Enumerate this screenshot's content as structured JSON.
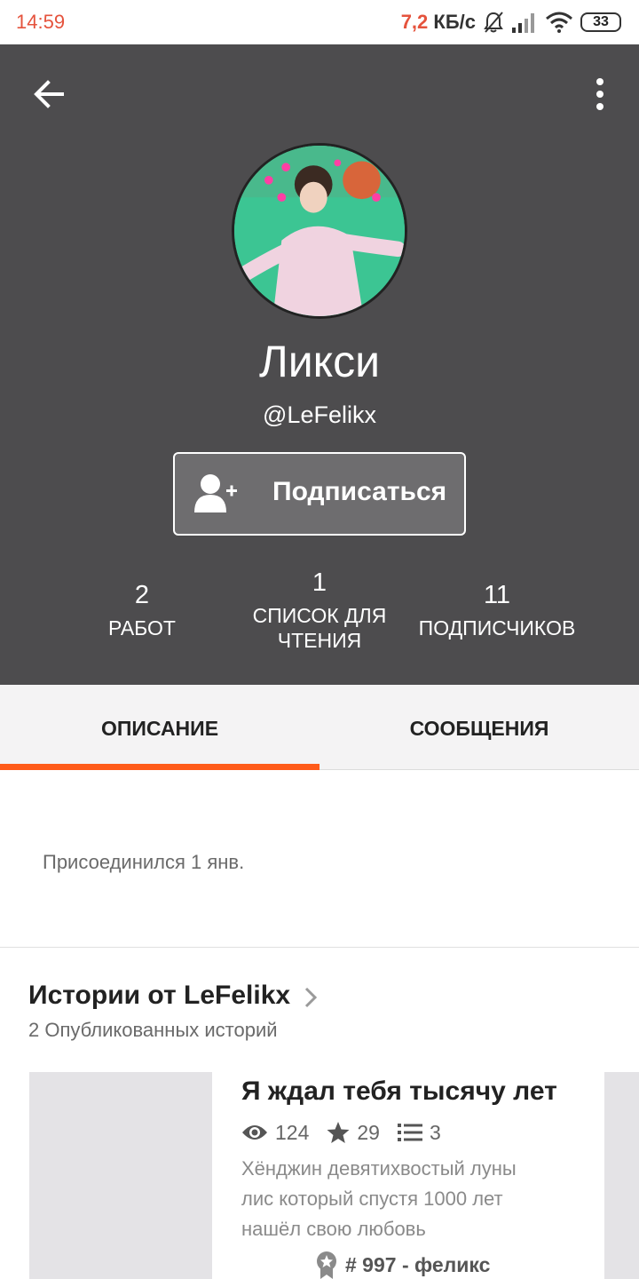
{
  "status_bar": {
    "time": "14:59",
    "speed_value": "7,2",
    "speed_unit": "КБ/с",
    "battery": "33"
  },
  "profile": {
    "display_name": "Ликси",
    "username": "@LeFelikx",
    "follow_label": "Подписаться",
    "stats": [
      {
        "value": "2",
        "label": "РАБОТ"
      },
      {
        "value": "1",
        "label_line1": "СПИСОК ДЛЯ",
        "label_line2": "ЧТЕНИЯ"
      },
      {
        "value": "11",
        "label": "ПОДПИСЧИКОВ"
      }
    ]
  },
  "tabs": [
    {
      "label": "ОПИСАНИЕ",
      "active": true
    },
    {
      "label": "СООБЩЕНИЯ",
      "active": false
    }
  ],
  "about": {
    "joined": "Присоединился 1 янв."
  },
  "stories": {
    "title": "Истории от LeFelikx",
    "count_text": "2 Опубликованных историй",
    "items": [
      {
        "title": "Я ждал тебя тысячу лет",
        "views": "124",
        "votes": "29",
        "parts": "3",
        "description_lines": [
          "Хёнджин девятихвостый луны",
          "лис который спустя 1000 лет",
          "нашёл свою любовь"
        ],
        "rank": "# 997 - феликс"
      }
    ]
  },
  "colors": {
    "header_bg": "#4d4c4e",
    "accent": "#ff5b1a",
    "tab_bg": "#f4f3f4"
  },
  "icons": [
    "arrow-left-icon",
    "more-vert-icon",
    "add-user-icon",
    "eye-icon",
    "star-icon",
    "list-icon",
    "chevron-right-icon",
    "ribbon-icon",
    "mute-bell-icon",
    "signal-icon",
    "wifi-icon"
  ]
}
